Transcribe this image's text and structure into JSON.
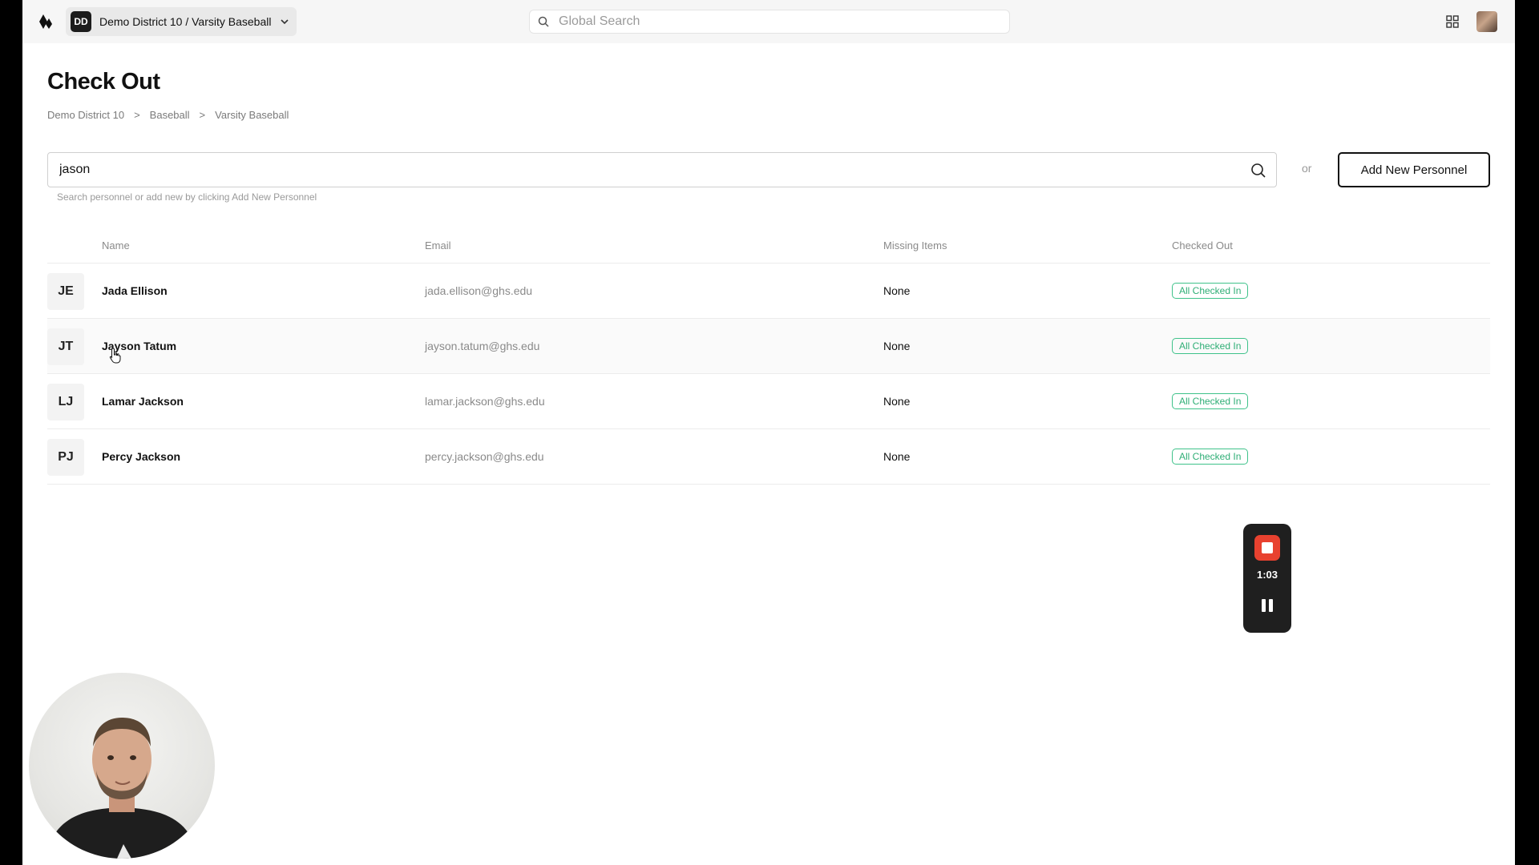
{
  "topbar": {
    "org_initials": "DD",
    "org_name": "Demo District 10 / Varsity Baseball",
    "search_placeholder": "Global Search"
  },
  "page": {
    "title": "Check Out",
    "breadcrumb": [
      "Demo District 10",
      "Baseball",
      "Varsity Baseball"
    ],
    "breadcrumb_separator": ">"
  },
  "personnel_search": {
    "value": "jason",
    "helper": "Search personnel or add new by clicking Add New Personnel",
    "or_label": "or",
    "add_button": "Add New Personnel"
  },
  "table": {
    "headers": {
      "name": "Name",
      "email": "Email",
      "missing": "Missing Items",
      "checked_out": "Checked Out"
    },
    "rows": [
      {
        "initials": "JE",
        "name": "Jada Ellison",
        "email": "jada.ellison@ghs.edu",
        "missing": "None",
        "status": "All Checked In"
      },
      {
        "initials": "JT",
        "name": "Jayson Tatum",
        "email": "jayson.tatum@ghs.edu",
        "missing": "None",
        "status": "All Checked In"
      },
      {
        "initials": "LJ",
        "name": "Lamar Jackson",
        "email": "lamar.jackson@ghs.edu",
        "missing": "None",
        "status": "All Checked In"
      },
      {
        "initials": "PJ",
        "name": "Percy Jackson",
        "email": "percy.jackson@ghs.edu",
        "missing": "None",
        "status": "All Checked In"
      }
    ]
  },
  "recorder": {
    "elapsed": "1:03"
  },
  "colors": {
    "status_green": "#2fae76",
    "record_red": "#e8412f",
    "recorder_bg": "#1f1f1f"
  },
  "icons": [
    "logo-icon",
    "chevron-down-icon",
    "search-icon",
    "grid-icon",
    "cursor-icon",
    "stop-icon",
    "pause-icon"
  ]
}
